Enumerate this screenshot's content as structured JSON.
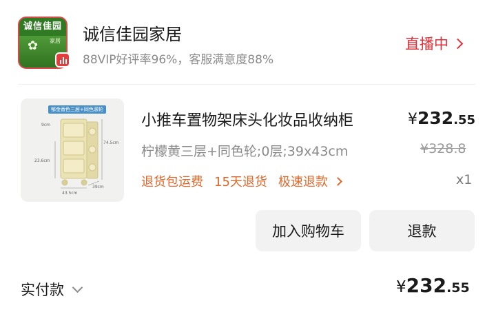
{
  "shop": {
    "logo_text": "诚信佳园",
    "logo_subtext": "家居",
    "name": "诚信佳园家居",
    "stats": "88VIP好评率96%，客服满意度88%",
    "live_label": "直播中"
  },
  "product": {
    "thumb_tag": "郁金香色三层+同色滚轮",
    "thumb_dims": [
      "74.5cm",
      "43.5cm",
      "39cm",
      "9cm",
      "23.6cm"
    ],
    "title": "小推车置物架床头化妆品收纳柜",
    "price_symbol": "¥",
    "price_integer": "232",
    "price_decimal": ".55",
    "variant": "柠檬黄三层+同色轮;0层;39x43cm",
    "original_price": "¥328.8",
    "services": [
      "退货包运费",
      "15天退货",
      "极速退款"
    ],
    "quantity": "x1"
  },
  "actions": {
    "add_to_cart": "加入购物车",
    "refund": "退款"
  },
  "payment": {
    "label": "实付款",
    "symbol": "¥",
    "integer": "232",
    "decimal": ".55"
  },
  "colors": {
    "accent_red": "#e0313a",
    "service_orange": "#e0672a",
    "logo_green": "#3f8a2e",
    "button_bg": "#f2f2f2"
  }
}
